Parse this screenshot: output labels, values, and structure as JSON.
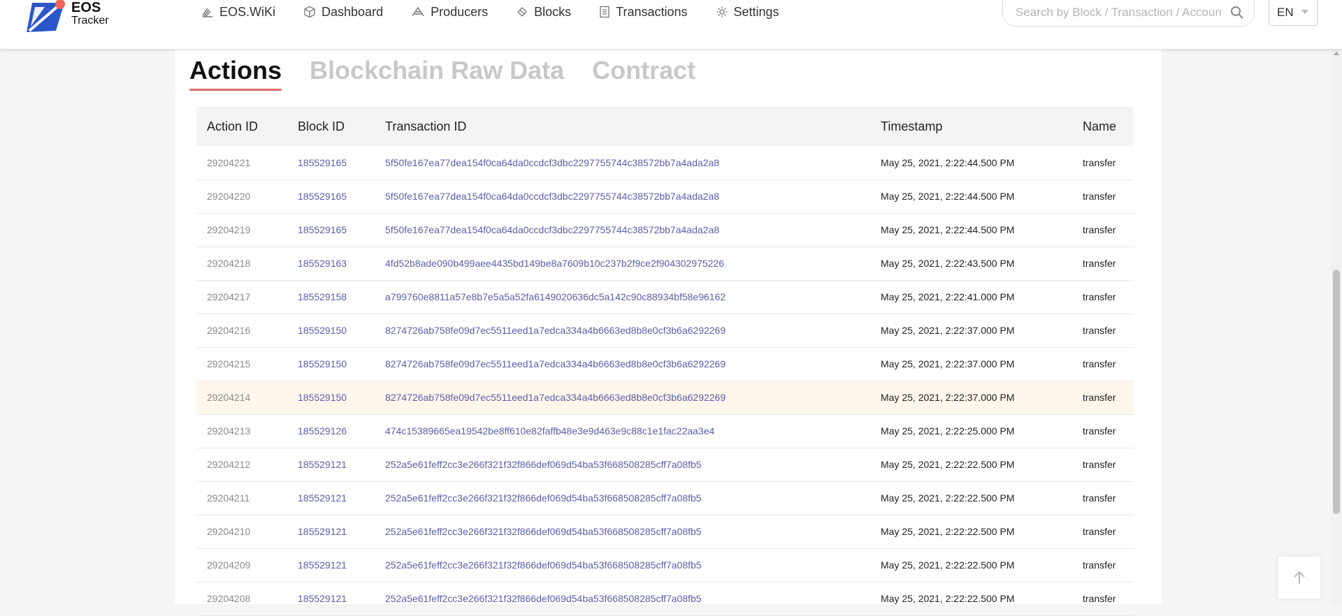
{
  "header": {
    "logo": {
      "title": "EOS",
      "subtitle": "Tracker"
    },
    "nav": [
      {
        "label": "EOS.WiKi",
        "icon": "wiki-icon"
      },
      {
        "label": "Dashboard",
        "icon": "cube-icon"
      },
      {
        "label": "Producers",
        "icon": "producers-icon"
      },
      {
        "label": "Blocks",
        "icon": "blocks-icon"
      },
      {
        "label": "Transactions",
        "icon": "document-icon"
      },
      {
        "label": "Settings",
        "icon": "gear-icon"
      }
    ],
    "search": {
      "placeholder": "Search by Block / Transaction / Account"
    },
    "language": {
      "selected": "EN"
    }
  },
  "tabs": [
    {
      "label": "Actions",
      "active": true
    },
    {
      "label": "Blockchain Raw Data",
      "active": false
    },
    {
      "label": "Contract",
      "active": false
    }
  ],
  "table": {
    "columns": [
      "Action ID",
      "Block ID",
      "Transaction ID",
      "Timestamp",
      "Name"
    ],
    "rows": [
      {
        "action_id": "29204221",
        "block_id": "185529165",
        "tx_id": "5f50fe167ea77dea154f0ca64da0ccdcf3dbc2297755744c38572bb7a4ada2a8",
        "timestamp": "May 25, 2021, 2:22:44.500 PM",
        "name": "transfer"
      },
      {
        "action_id": "29204220",
        "block_id": "185529165",
        "tx_id": "5f50fe167ea77dea154f0ca64da0ccdcf3dbc2297755744c38572bb7a4ada2a8",
        "timestamp": "May 25, 2021, 2:22:44.500 PM",
        "name": "transfer"
      },
      {
        "action_id": "29204219",
        "block_id": "185529165",
        "tx_id": "5f50fe167ea77dea154f0ca64da0ccdcf3dbc2297755744c38572bb7a4ada2a8",
        "timestamp": "May 25, 2021, 2:22:44.500 PM",
        "name": "transfer"
      },
      {
        "action_id": "29204218",
        "block_id": "185529163",
        "tx_id": "4fd52b8ade090b499aee4435bd149be8a7609b10c237b2f9ce2f904302975226",
        "timestamp": "May 25, 2021, 2:22:43.500 PM",
        "name": "transfer"
      },
      {
        "action_id": "29204217",
        "block_id": "185529158",
        "tx_id": "a799760e8811a57e8b7e5a5a52fa6149020636dc5a142c90c88934bf58e96162",
        "timestamp": "May 25, 2021, 2:22:41.000 PM",
        "name": "transfer"
      },
      {
        "action_id": "29204216",
        "block_id": "185529150",
        "tx_id": "8274726ab758fe09d7ec5511eed1a7edca334a4b6663ed8b8e0cf3b6a6292269",
        "timestamp": "May 25, 2021, 2:22:37.000 PM",
        "name": "transfer"
      },
      {
        "action_id": "29204215",
        "block_id": "185529150",
        "tx_id": "8274726ab758fe09d7ec5511eed1a7edca334a4b6663ed8b8e0cf3b6a6292269",
        "timestamp": "May 25, 2021, 2:22:37.000 PM",
        "name": "transfer"
      },
      {
        "action_id": "29204214",
        "block_id": "185529150",
        "tx_id": "8274726ab758fe09d7ec5511eed1a7edca334a4b6663ed8b8e0cf3b6a6292269",
        "timestamp": "May 25, 2021, 2:22:37.000 PM",
        "name": "transfer",
        "highlighted": true
      },
      {
        "action_id": "29204213",
        "block_id": "185529126",
        "tx_id": "474c15389665ea19542be8ff610e82faffb48e3e9d463e9c88c1e1fac22aa3e4",
        "timestamp": "May 25, 2021, 2:22:25.000 PM",
        "name": "transfer"
      },
      {
        "action_id": "29204212",
        "block_id": "185529121",
        "tx_id": "252a5e61feff2cc3e266f321f32f866def069d54ba53f668508285cff7a08fb5",
        "timestamp": "May 25, 2021, 2:22:22.500 PM",
        "name": "transfer"
      },
      {
        "action_id": "29204211",
        "block_id": "185529121",
        "tx_id": "252a5e61feff2cc3e266f321f32f866def069d54ba53f668508285cff7a08fb5",
        "timestamp": "May 25, 2021, 2:22:22.500 PM",
        "name": "transfer"
      },
      {
        "action_id": "29204210",
        "block_id": "185529121",
        "tx_id": "252a5e61feff2cc3e266f321f32f866def069d54ba53f668508285cff7a08fb5",
        "timestamp": "May 25, 2021, 2:22:22.500 PM",
        "name": "transfer"
      },
      {
        "action_id": "29204209",
        "block_id": "185529121",
        "tx_id": "252a5e61feff2cc3e266f321f32f866def069d54ba53f668508285cff7a08fb5",
        "timestamp": "May 25, 2021, 2:22:22.500 PM",
        "name": "transfer"
      },
      {
        "action_id": "29204208",
        "block_id": "185529121",
        "tx_id": "252a5e61feff2cc3e266f321f32f866def069d54ba53f668508285cff7a08fb5",
        "timestamp": "May 25, 2021, 2:22:22.500 PM",
        "name": "transfer"
      }
    ]
  },
  "colors": {
    "accent_underline": "#e06a6a",
    "link": "#5b5fa8",
    "logo_blue": "#2b55c8",
    "logo_red": "#f0645a",
    "row_highlight": "#fff6ec"
  }
}
